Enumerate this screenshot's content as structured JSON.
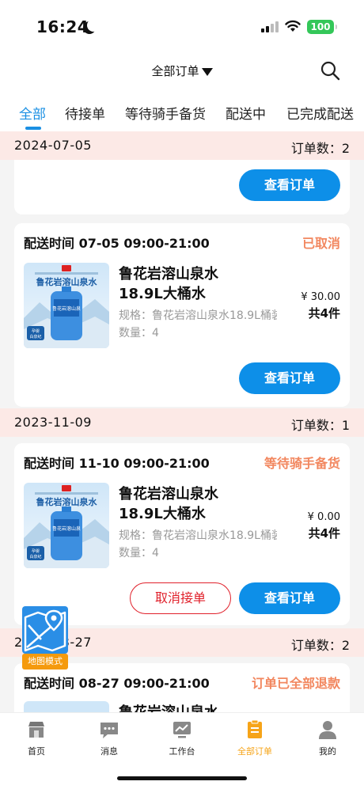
{
  "status_bar": {
    "time": "16:24",
    "battery": "100"
  },
  "header": {
    "title": "全部订单"
  },
  "tabs": [
    {
      "label": "全部",
      "active": true
    },
    {
      "label": "待接单",
      "active": false
    },
    {
      "label": "等待骑手备货",
      "active": false
    },
    {
      "label": "配送中",
      "active": false
    },
    {
      "label": "已完成配送",
      "active": false
    }
  ],
  "groups": [
    {
      "date": "2024-07-05",
      "count": "订单数：2"
    },
    {
      "date": "2023-11-09",
      "count": "订单数：1"
    },
    {
      "date": "2023-08-27",
      "count": "订单数：2"
    }
  ],
  "orders": [
    {
      "time": "配送时间  07-05 09:00-21:00",
      "status": "已取消",
      "product_name": "鲁花岩溶山泉水18.9L大桶水",
      "spec": "规格：鲁花岩溶山泉水18.9L桶装水",
      "qty": "数量：4",
      "price": "¥ 30.00",
      "count": "共4件",
      "view_label": "查看订单"
    },
    {
      "time": "配送时间  11-10 09:00-21:00",
      "status": "等待骑手备货",
      "product_name": "鲁花岩溶山泉水18.9L大桶水",
      "spec": "规格：鲁花岩溶山泉水18.9L桶装水",
      "qty": "数量：4",
      "price": "¥ 0.00",
      "count": "共4件",
      "cancel_label": "取消接单",
      "view_label": "查看订单"
    },
    {
      "time": "配送时间  08-27 09:00-21:00",
      "status": "订单已全部退款",
      "product_name": "鲁花岩溶山泉水"
    }
  ],
  "top_card": {
    "view_label": "查看订单"
  },
  "product_image": {
    "brand": "鲁花岩溶山泉水",
    "badge": "孕婴\n白泉纪",
    "top_text": "源自山东·深层岩溶地质地下水源"
  },
  "map_mode": {
    "label": "地图模式"
  },
  "bottom_nav": [
    {
      "label": "首页",
      "icon": "store-icon",
      "active": false
    },
    {
      "label": "消息",
      "icon": "message-icon",
      "active": false
    },
    {
      "label": "工作台",
      "icon": "workbench-icon",
      "active": false
    },
    {
      "label": "全部订单",
      "icon": "orders-icon",
      "active": true
    },
    {
      "label": "我的",
      "icon": "profile-icon",
      "active": false
    }
  ],
  "colors": {
    "accent": "#1a8fe3",
    "status_orange": "#f2875f",
    "cancel_red": "#e0212b",
    "nav_active": "#f6a418",
    "group_bg": "#fce9e6"
  }
}
